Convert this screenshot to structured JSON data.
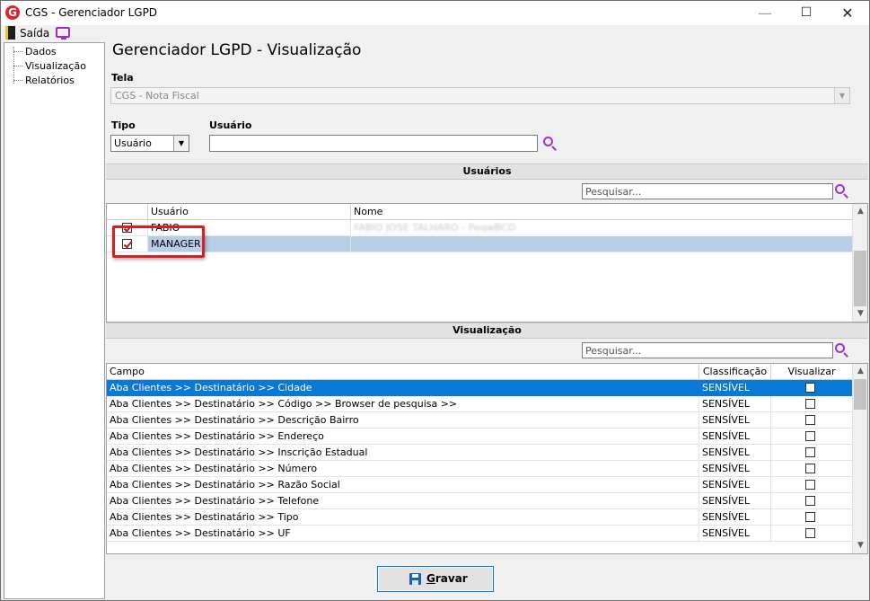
{
  "window": {
    "title": "CGS - Gerenciador LGPD",
    "logo_letter": "G",
    "minimize_glyph": "—",
    "maximize_glyph": "☐",
    "close_glyph": "✕"
  },
  "menubar": {
    "exit_label": "Saída"
  },
  "sidebar": {
    "items": [
      {
        "label": "Dados"
      },
      {
        "label": "Visualização"
      },
      {
        "label": "Relatórios"
      }
    ]
  },
  "main": {
    "title": "Gerenciador LGPD - Visualização",
    "tela": {
      "label": "Tela",
      "value": "CGS - Nota Fiscal"
    },
    "tipo": {
      "label": "Tipo",
      "value": "Usuário"
    },
    "usuario": {
      "label": "Usuário",
      "value": ""
    }
  },
  "users_section": {
    "title": "Usuários",
    "filter_placeholder": "Pesquisar...",
    "columns": [
      "",
      "Usuário",
      "Nome"
    ],
    "rows": [
      {
        "checked": true,
        "usuario": "FABIO",
        "nome": "FABIO JOSE TALHARO - PeqwBCD"
      },
      {
        "checked": true,
        "usuario": "MANAGER",
        "nome": ""
      }
    ]
  },
  "fields_section": {
    "title": "Visualização",
    "filter_placeholder": "Pesquisar...",
    "columns": [
      "Campo",
      "Classificação",
      "Visualizar"
    ],
    "rows": [
      {
        "campo": "Aba Clientes >> Destinatário >> Cidade",
        "classificacao": "SENSÍVEL",
        "visualizar": false
      },
      {
        "campo": "Aba Clientes >> Destinatário >> Código >> Browser de pesquisa >>",
        "classificacao": "SENSÍVEL",
        "visualizar": false
      },
      {
        "campo": "Aba Clientes >> Destinatário >> Descrição Bairro",
        "classificacao": "SENSÍVEL",
        "visualizar": false
      },
      {
        "campo": "Aba Clientes >> Destinatário >> Endereço",
        "classificacao": "SENSÍVEL",
        "visualizar": false
      },
      {
        "campo": "Aba Clientes >> Destinatário >> Inscrição Estadual",
        "classificacao": "SENSÍVEL",
        "visualizar": false
      },
      {
        "campo": "Aba Clientes >> Destinatário >> Número",
        "classificacao": "SENSÍVEL",
        "visualizar": false
      },
      {
        "campo": "Aba Clientes >> Destinatário >> Razão Social",
        "classificacao": "SENSÍVEL",
        "visualizar": false
      },
      {
        "campo": "Aba Clientes >> Destinatário >> Telefone",
        "classificacao": "SENSÍVEL",
        "visualizar": false
      },
      {
        "campo": "Aba Clientes >> Destinatário >> Tipo",
        "classificacao": "SENSÍVEL",
        "visualizar": false
      },
      {
        "campo": "Aba Clientes >> Destinatário >> UF",
        "classificacao": "SENSÍVEL",
        "visualizar": false
      }
    ]
  },
  "footer": {
    "save_label_first": "G",
    "save_label_rest": "ravar"
  },
  "colors": {
    "accent": "#0a78d7",
    "brand": "#d8262b",
    "search_icon": "#a134c9",
    "highlight": "#d81e1e"
  }
}
